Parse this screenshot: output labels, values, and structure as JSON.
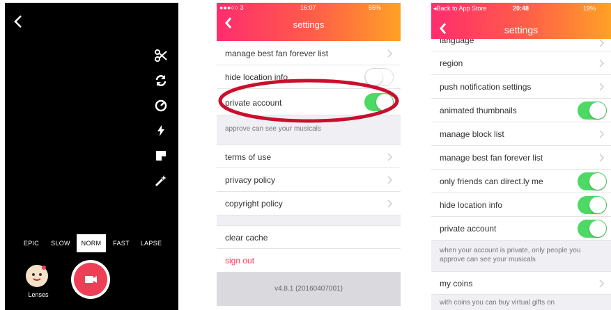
{
  "camera": {
    "speeds": [
      "EPIC",
      "SLOW",
      "NORM",
      "FAST",
      "LAPSE"
    ],
    "active_speed": "NORM",
    "lenses_label": "Lenses",
    "tools": [
      "scissors-icon",
      "refresh-icon",
      "timer-icon",
      "flash-icon",
      "sticker-icon",
      "magic-wand-icon"
    ],
    "record_color": "#ee3f57"
  },
  "settings_old": {
    "status": {
      "carrier": "●●●○○ 3",
      "time": "16:07",
      "battery": "55%"
    },
    "title": "settings",
    "rows": [
      {
        "label": "manage best fan forever list",
        "type": "chevron"
      },
      {
        "label": "hide location info",
        "type": "toggle-off"
      },
      {
        "label": "private account",
        "type": "toggle-on"
      }
    ],
    "private_note": "approve can see your musicals",
    "rows2": [
      {
        "label": "terms of use"
      },
      {
        "label": "privacy policy"
      },
      {
        "label": "copyright policy"
      }
    ],
    "clear_cache": "clear cache",
    "sign_out": "sign out",
    "version": "v4.8.1 (20160407001)",
    "highlight_color": "#c8102e"
  },
  "settings_new": {
    "status": {
      "back": "◂Back to App Store",
      "time": "20:48",
      "battery": "19%"
    },
    "title": "settings",
    "partial_row": "language",
    "rows": [
      {
        "label": "region",
        "type": "chevron"
      },
      {
        "label": "push notification settings",
        "type": "chevron"
      },
      {
        "label": "animated thumbnails",
        "type": "toggle-on"
      },
      {
        "label": "manage block list",
        "type": "chevron"
      },
      {
        "label": "manage best fan forever list",
        "type": "chevron"
      },
      {
        "label": "only friends can direct.ly me",
        "type": "toggle-on"
      },
      {
        "label": "hide location info",
        "type": "toggle-on"
      },
      {
        "label": "private account",
        "type": "toggle-on"
      }
    ],
    "private_note": "when your account is private, only people you approve can see your musicals",
    "coins_label": "my coins",
    "coins_note": "with coins you can buy virtual gifts on"
  }
}
